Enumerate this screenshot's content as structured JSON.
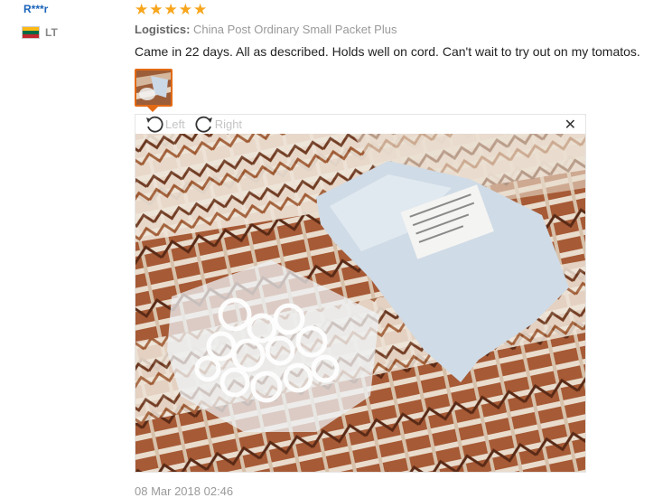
{
  "buyer": {
    "name": "R***r",
    "country": "LT",
    "flag_colors": [
      "#fdb913",
      "#006a44",
      "#c1272d"
    ]
  },
  "review": {
    "rating": 5,
    "star_color": "#f7a51b",
    "logistics_label": "Logistics:",
    "logistics_value": "China Post Ordinary Small Packet Plus",
    "text": "Came in 22 days. All as described. Holds well on cord. Can't wait to try out on my tomatos.",
    "date": "08 Mar 2018 02:46"
  },
  "viewer": {
    "rotate_left_label": "Left",
    "rotate_right_label": "Right",
    "close_icon": "close-icon",
    "photo_description_icon": "review-photo"
  },
  "colors": {
    "accent": "#e36a14",
    "link": "#1a63b9"
  }
}
